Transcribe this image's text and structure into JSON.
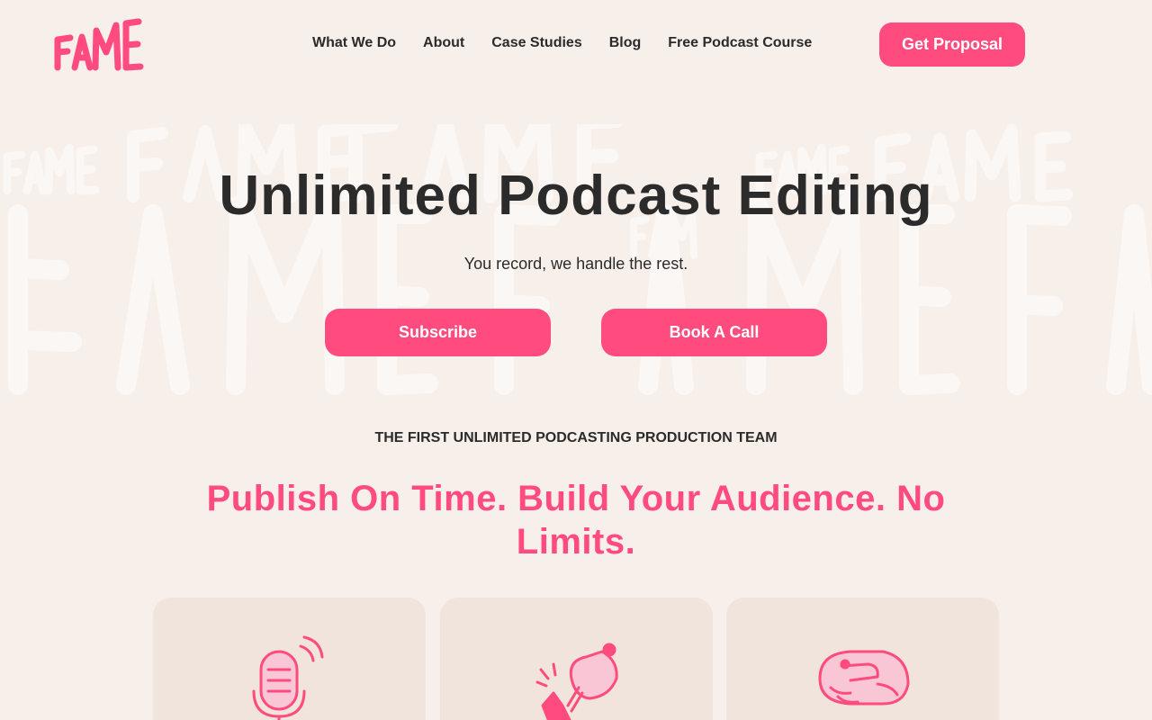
{
  "brand": {
    "logo_text": "FAME",
    "accent": "#ff4b7d",
    "background": "#f7efea"
  },
  "nav": {
    "items": [
      {
        "label": "What We Do"
      },
      {
        "label": "About"
      },
      {
        "label": "Case Studies"
      },
      {
        "label": "Blog"
      },
      {
        "label": "Free Podcast Course"
      }
    ],
    "cta_label": "Get Proposal"
  },
  "hero": {
    "title": "Unlimited Podcast Editing",
    "subtitle": "You record, we handle the rest.",
    "primary_label": "Subscribe",
    "secondary_label": "Book A Call",
    "background_pattern": "FAME"
  },
  "section": {
    "eyebrow": "THE FIRST UNLIMITED PODCASTING PRODUCTION TEAM",
    "headline": "Publish On Time. Build Your Audience. No Limits."
  },
  "cards": [
    {
      "icon": "microphone-icon"
    },
    {
      "icon": "ice-cream-hand-icon"
    },
    {
      "icon": "handshake-icon"
    }
  ]
}
